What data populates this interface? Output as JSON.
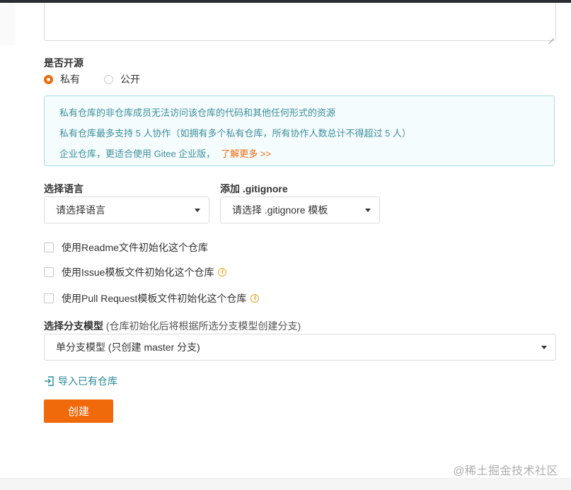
{
  "open_source": {
    "label": "是否开源",
    "options": [
      {
        "label": "私有",
        "checked": true
      },
      {
        "label": "公开",
        "checked": false
      }
    ]
  },
  "info": {
    "line1": "私有仓库的非仓库成员无法访问该仓库的代码和其他任何形式的资源",
    "line2": "私有仓库最多支持 5 人协作（如拥有多个私有仓库，所有协作人数总计不得超过 5 人）",
    "line3": "企业仓库，更适合使用 Gitee 企业版，",
    "more_link": "了解更多 >>"
  },
  "language": {
    "label": "选择语言",
    "value": "请选择语言"
  },
  "gitignore": {
    "label": "添加 .gitignore",
    "value": "请选择 .gitignore 模板"
  },
  "checkboxes": [
    {
      "label": "使用Readme文件初始化这个仓库",
      "checked": false,
      "has_info": false
    },
    {
      "label": "使用Issue模板文件初始化这个仓库",
      "checked": false,
      "has_info": true
    },
    {
      "label": "使用Pull Request模板文件初始化这个仓库",
      "checked": false,
      "has_info": true
    }
  ],
  "branch_model": {
    "label": "选择分支模型",
    "hint": " (仓库初始化后将根据所选分支模型创建分支)",
    "value": "单分支模型 (只创建 master 分支)"
  },
  "import_link": "导入已有仓库",
  "create_button": "创建",
  "watermark": "@稀土掘金技术社区",
  "colors": {
    "accent": "#f0690a",
    "info_text": "#3e8e9c",
    "info_bg": "#f4fcfd",
    "link": "#2a8a9a"
  },
  "icons": {
    "info": "info-circle-icon",
    "import": "import-icon",
    "dropdown": "caret-down-icon"
  }
}
